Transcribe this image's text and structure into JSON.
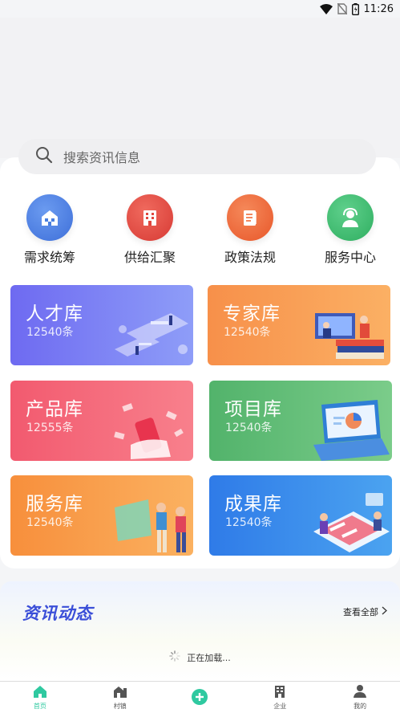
{
  "status": {
    "time": "11:26"
  },
  "search": {
    "placeholder": "搜索资讯信息"
  },
  "quick": [
    {
      "label": "需求统筹",
      "icon": "house-icon",
      "color": "#4a7fe0"
    },
    {
      "label": "供给汇聚",
      "icon": "building-icon",
      "color": "#e0463e"
    },
    {
      "label": "政策法规",
      "icon": "document-icon",
      "color": "#ee6b38"
    },
    {
      "label": "服务中心",
      "icon": "headset-user-icon",
      "color": "#3cbd72"
    }
  ],
  "libraries": [
    {
      "name": "人才库",
      "count": "12540条",
      "colors": [
        "#6f6df2",
        "#8c9cf7"
      ]
    },
    {
      "name": "专家库",
      "count": "12540条",
      "colors": [
        "#f7904a",
        "#fbb064"
      ]
    },
    {
      "name": "产品库",
      "count": "12555条",
      "colors": [
        "#f25a6f",
        "#f8808c"
      ]
    },
    {
      "name": "项目库",
      "count": "12540条",
      "colors": [
        "#54b46d",
        "#7bcc8a"
      ]
    },
    {
      "name": "服务库",
      "count": "12540条",
      "colors": [
        "#f7903e",
        "#fbb160"
      ]
    },
    {
      "name": "成果库",
      "count": "12540条",
      "colors": [
        "#2f7be8",
        "#4ba3f0"
      ]
    }
  ],
  "news": {
    "title": "资讯动态",
    "more": "查看全部",
    "loading": "正在加载..."
  },
  "tabs": [
    {
      "label": "首页",
      "icon": "home-icon",
      "active": true
    },
    {
      "label": "村镇",
      "icon": "village-icon",
      "active": false
    },
    {
      "label": "",
      "icon": "plus-circle-icon",
      "active": false
    },
    {
      "label": "企业",
      "icon": "company-icon",
      "active": false
    },
    {
      "label": "我的",
      "icon": "user-icon",
      "active": false
    }
  ]
}
